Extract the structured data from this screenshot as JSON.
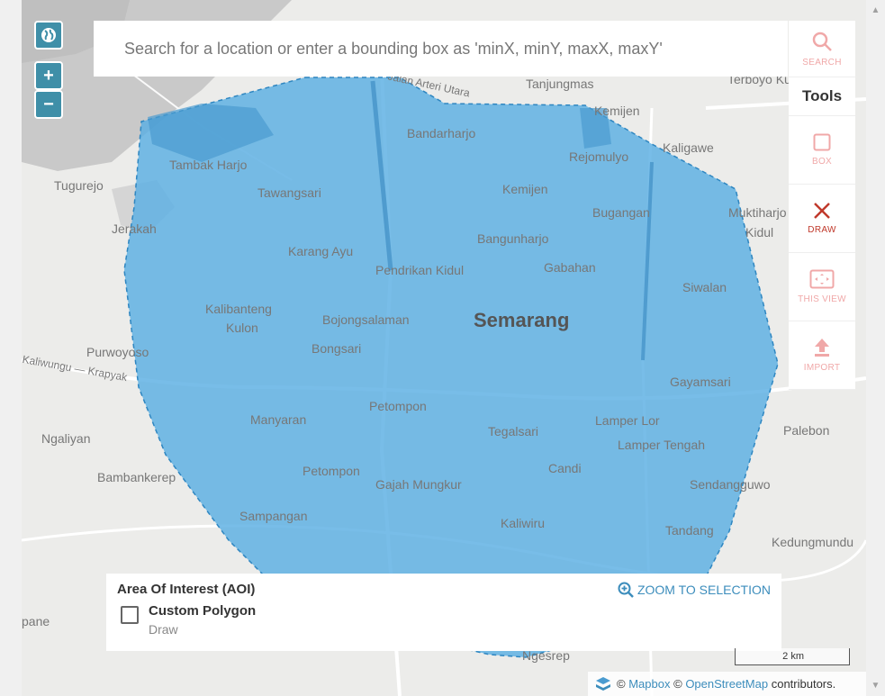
{
  "search": {
    "placeholder": "Search for a location or enter a bounding box as 'minX, minY, maxX, maxY'"
  },
  "map_controls": {
    "globe_icon": "globe-icon",
    "zoom_in": "+",
    "zoom_out": "−"
  },
  "tools": {
    "title": "Tools",
    "search_label": "SEARCH",
    "box_label": "BOX",
    "draw_label": "DRAW",
    "this_view_label": "THIS VIEW",
    "import_label": "IMPORT"
  },
  "aoi": {
    "title": "Area Of Interest (AOI)",
    "zoom_label": "ZOOM TO SELECTION",
    "polygon_name": "Custom Polygon",
    "polygon_source": "Draw"
  },
  "scale": {
    "label": "2 km"
  },
  "attribution": {
    "copy1": "©",
    "mapbox": "Mapbox",
    "copy2": "©",
    "osm": "OpenStreetMap",
    "suffix": "contributors."
  },
  "places": {
    "semarang": "Semarang",
    "jalan_arteri": "Jalan Arteri Utara",
    "tanjungmas": "Tanjungmas",
    "terboyo": "Terboyo Kulon",
    "kemijen_top": "Kemijen",
    "bandarharjo": "Bandarharjo",
    "rejomulyo": "Rejomulyo",
    "kaligawe": "Kaligawe",
    "tambak_harjo": "Tambak Harjo",
    "tugurejo": "Tugurejo",
    "tawangsari": "Tawangsari",
    "kemijen": "Kemijen",
    "bugangan": "Bugangan",
    "muktiharjo": "Muktiharjo",
    "kidul": "Kidul",
    "jerakah": "Jerakah",
    "karang_ayu": "Karang Ayu",
    "bangunharjo": "Bangunharjo",
    "pendrikan": "Pendrikan Kidul",
    "gabahan": "Gabahan",
    "siwalan": "Siwalan",
    "kalibanteng": "Kalibanteng",
    "kulon": "Kulon",
    "bojongsalaman": "Bojongsalaman",
    "bongsari": "Bongsari",
    "purwoyoso": "Purwoyoso",
    "kaliwungu": "Kaliwungu — Krapyak",
    "gayamsari": "Gayamsari",
    "petompon1": "Petompon",
    "ngaliyan": "Ngaliyan",
    "manyaran": "Manyaran",
    "tegalsari": "Tegalsari",
    "lamper_lor": "Lamper Lor",
    "lamper_tengah": "Lamper Tengah",
    "palebon": "Palebon",
    "bambankerep": "Bambankerep",
    "petompon2": "Petompon",
    "gajah_mungkur": "Gajah Mungkur",
    "candi": "Candi",
    "sendangguwo": "Sendangguwo",
    "sampangan": "Sampangan",
    "kaliwiru": "Kaliwiru",
    "tandang": "Tandang",
    "kedungmundu": "Kedungmundu",
    "ngesrep": "Ngesrep",
    "pane": "pane"
  },
  "colors": {
    "polygon_fill": "#5aaee3",
    "polygon_stroke": "#2e86c1",
    "control_bg": "#3f8fa8",
    "link": "#3c8dbc",
    "draw_active": "#c0392b",
    "tool_disabled": "#f0a8a8"
  }
}
